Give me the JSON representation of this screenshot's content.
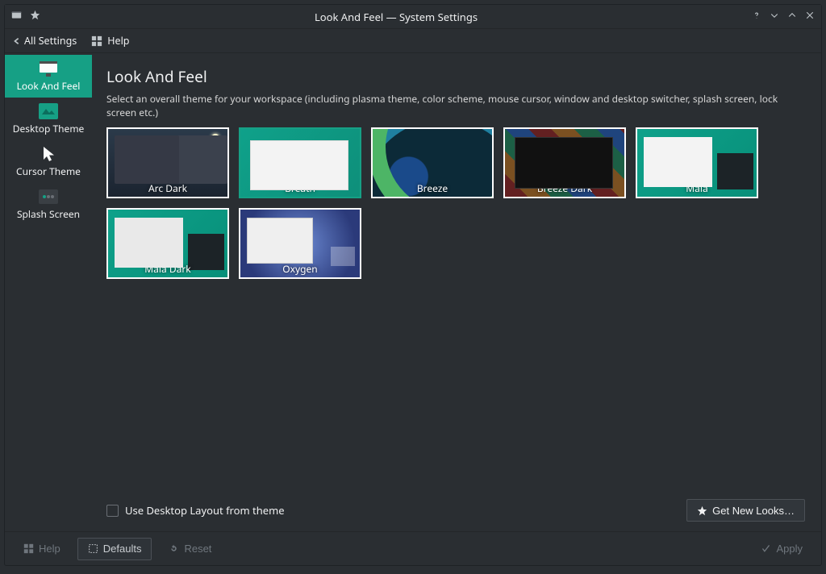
{
  "window": {
    "title": "Look And Feel — System Settings"
  },
  "toolbar": {
    "all_settings": "All Settings",
    "help": "Help"
  },
  "sidebar": {
    "items": [
      {
        "label": "Look And Feel"
      },
      {
        "label": "Desktop Theme"
      },
      {
        "label": "Cursor Theme"
      },
      {
        "label": "Splash Screen"
      }
    ]
  },
  "page": {
    "heading": "Look And Feel",
    "description": "Select an overall theme for your workspace (including plasma theme, color scheme, mouse cursor, window and desktop switcher, splash screen, lock screen etc.)",
    "themes": [
      {
        "label": "Arc Dark"
      },
      {
        "label": "Breath"
      },
      {
        "label": "Breeze"
      },
      {
        "label": "Breeze Dark"
      },
      {
        "label": "Maia"
      },
      {
        "label": "Maia Dark"
      },
      {
        "label": "Oxygen"
      }
    ],
    "selected_theme": "Breath",
    "use_desktop_layout": "Use Desktop Layout from theme",
    "get_new": "Get New Looks…"
  },
  "footer": {
    "help": "Help",
    "defaults": "Defaults",
    "reset": "Reset",
    "apply": "Apply"
  },
  "colors": {
    "accent": "#16a085",
    "bg": "#2a2e32"
  }
}
